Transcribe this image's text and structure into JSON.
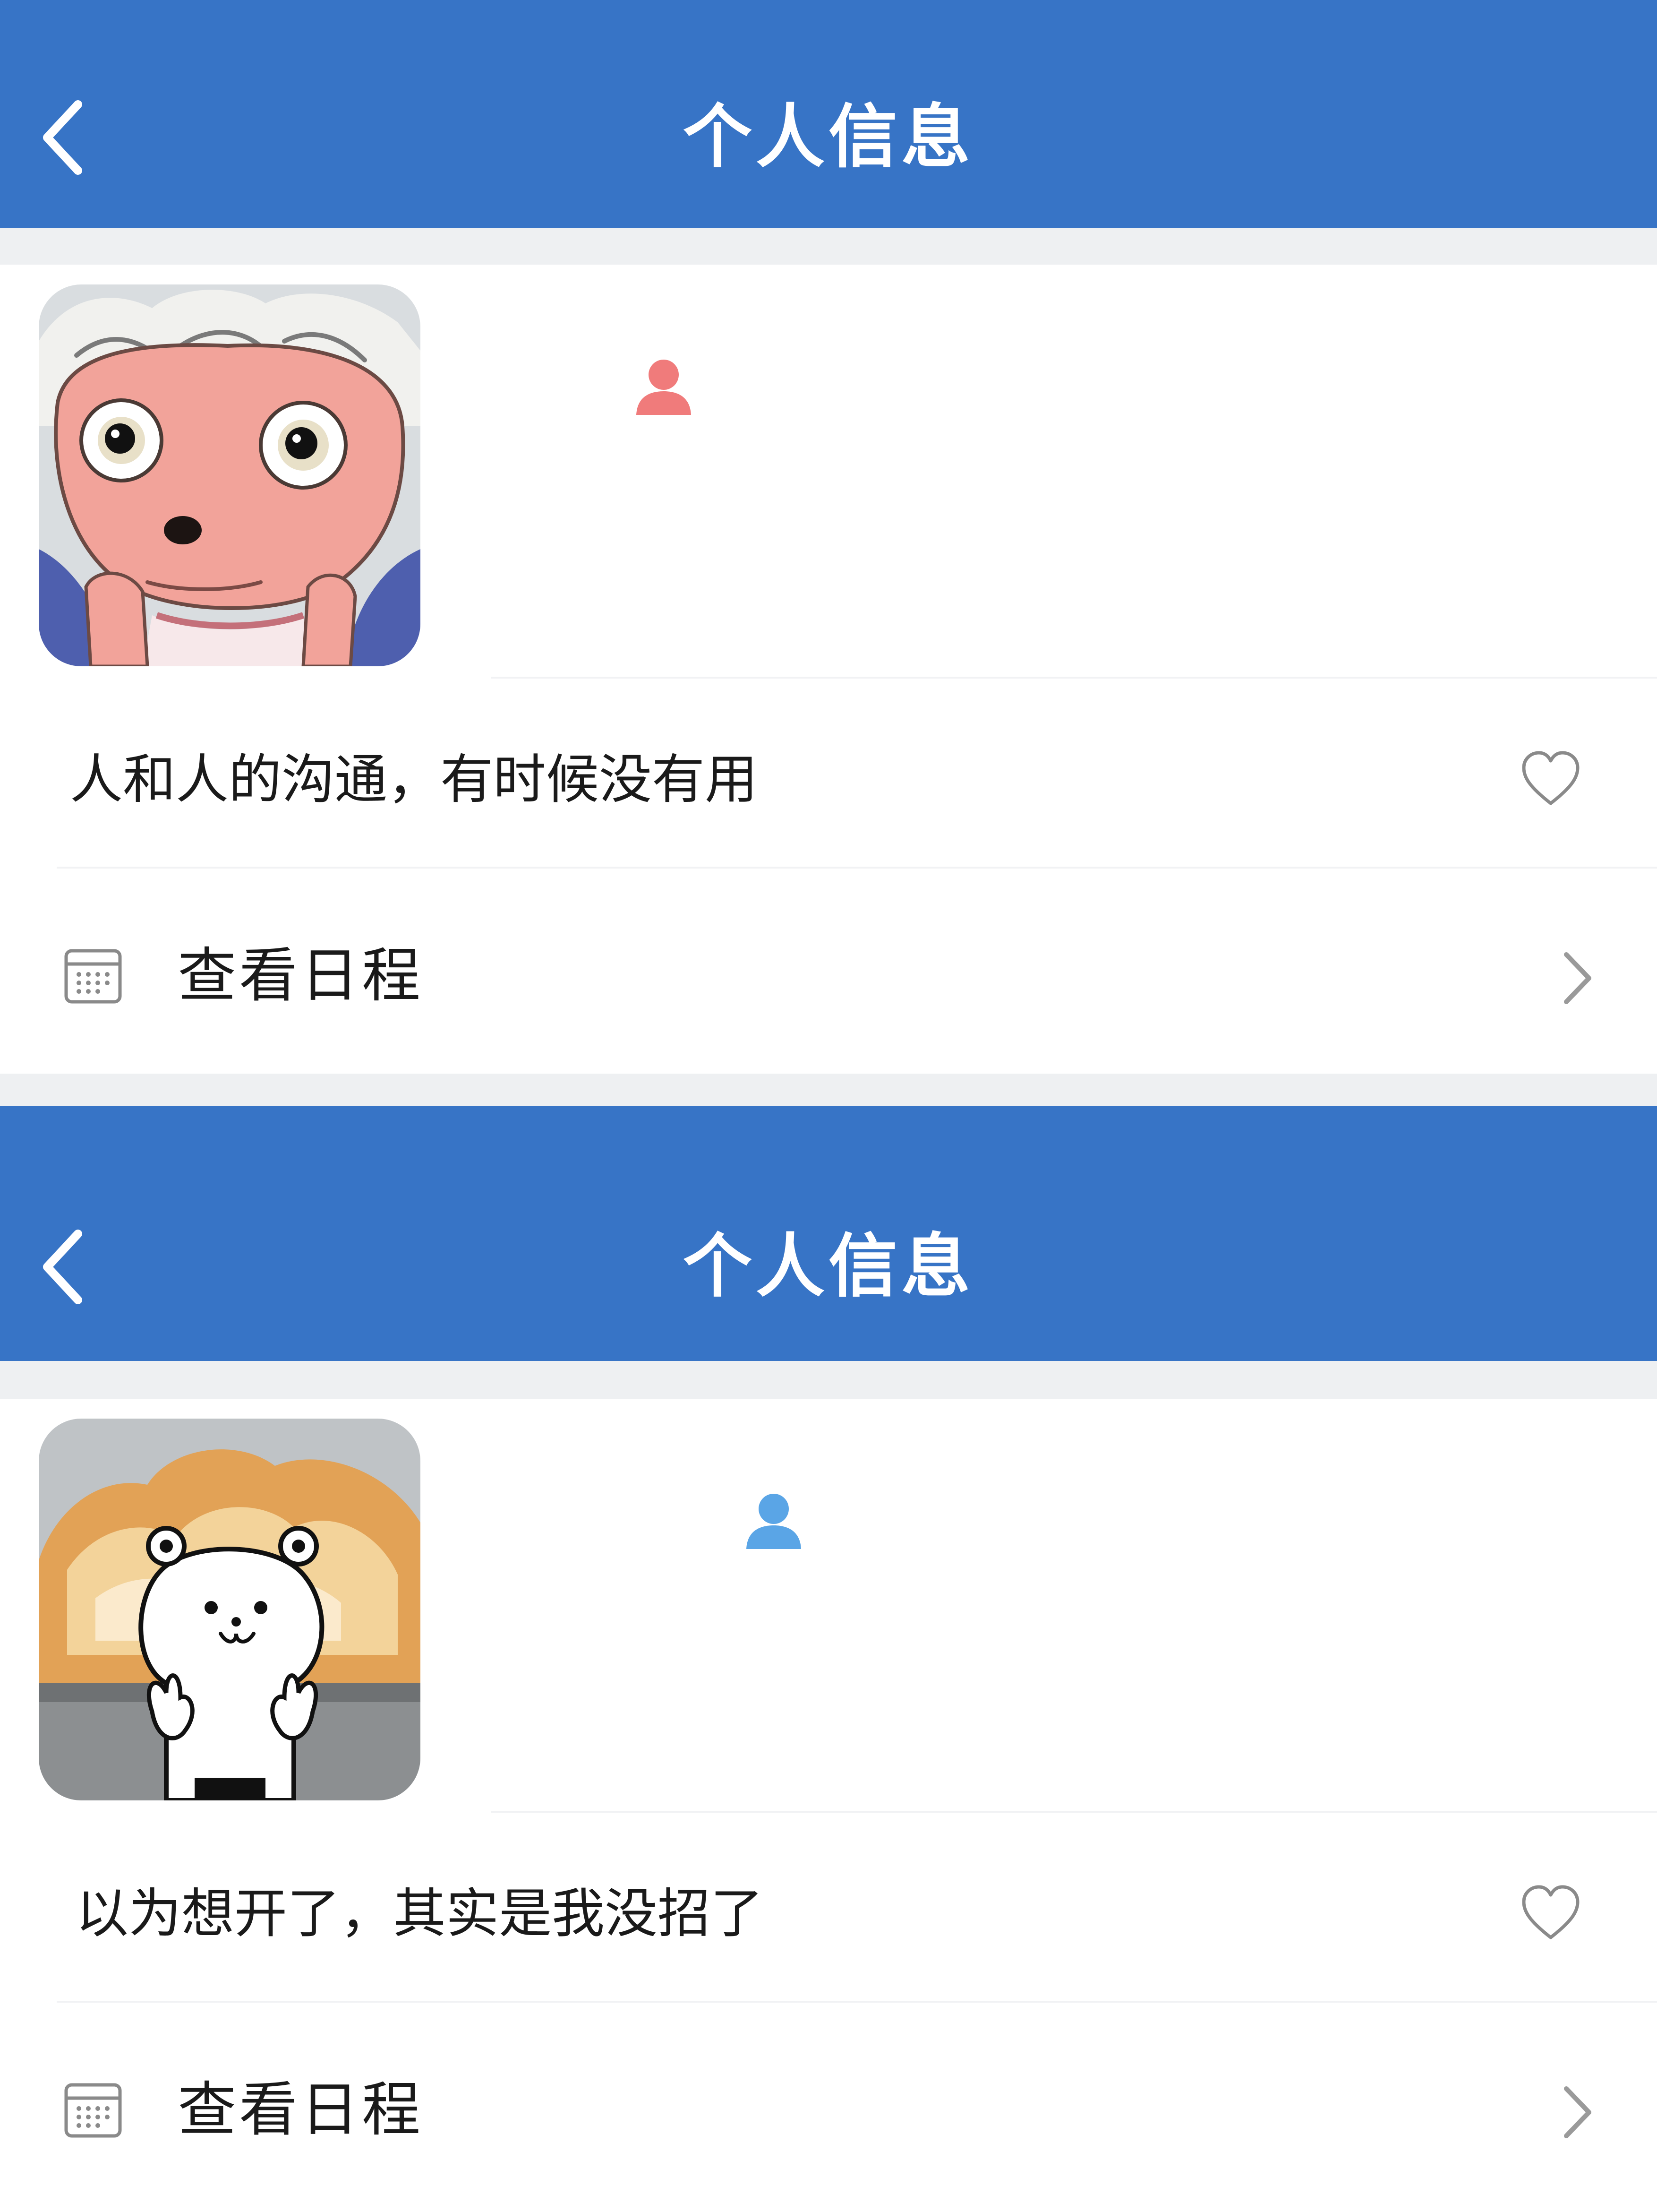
{
  "screens": [
    {
      "header": {
        "title": "个人信息",
        "back_icon": "chevron-left-icon"
      },
      "profile": {
        "avatar": "cartoon-sheep-avatar",
        "gender_icon": "user-icon",
        "gender_color": "#f07b7b"
      },
      "status": {
        "text": "人和人的沟通，有时候没有用",
        "like_icon": "heart-outline-icon"
      },
      "schedule": {
        "label": "查看日程",
        "icon": "calendar-icon",
        "chevron": "chevron-right-icon"
      }
    },
    {
      "header": {
        "title": "个人信息",
        "back_icon": "chevron-left-icon"
      },
      "profile": {
        "avatar": "bear-explosion-avatar",
        "gender_icon": "user-icon",
        "gender_color": "#5aa5e6"
      },
      "status": {
        "text": "以为想开了，其实是我没招了",
        "like_icon": "heart-outline-icon"
      },
      "schedule": {
        "label": "查看日程",
        "icon": "calendar-icon",
        "chevron": "chevron-right-icon"
      }
    }
  ],
  "colors": {
    "nav_bar": "#3774c6",
    "background": "#eef0f2",
    "card": "#ffffff",
    "text": "#1a1a1a",
    "icon_gray": "#999999"
  }
}
